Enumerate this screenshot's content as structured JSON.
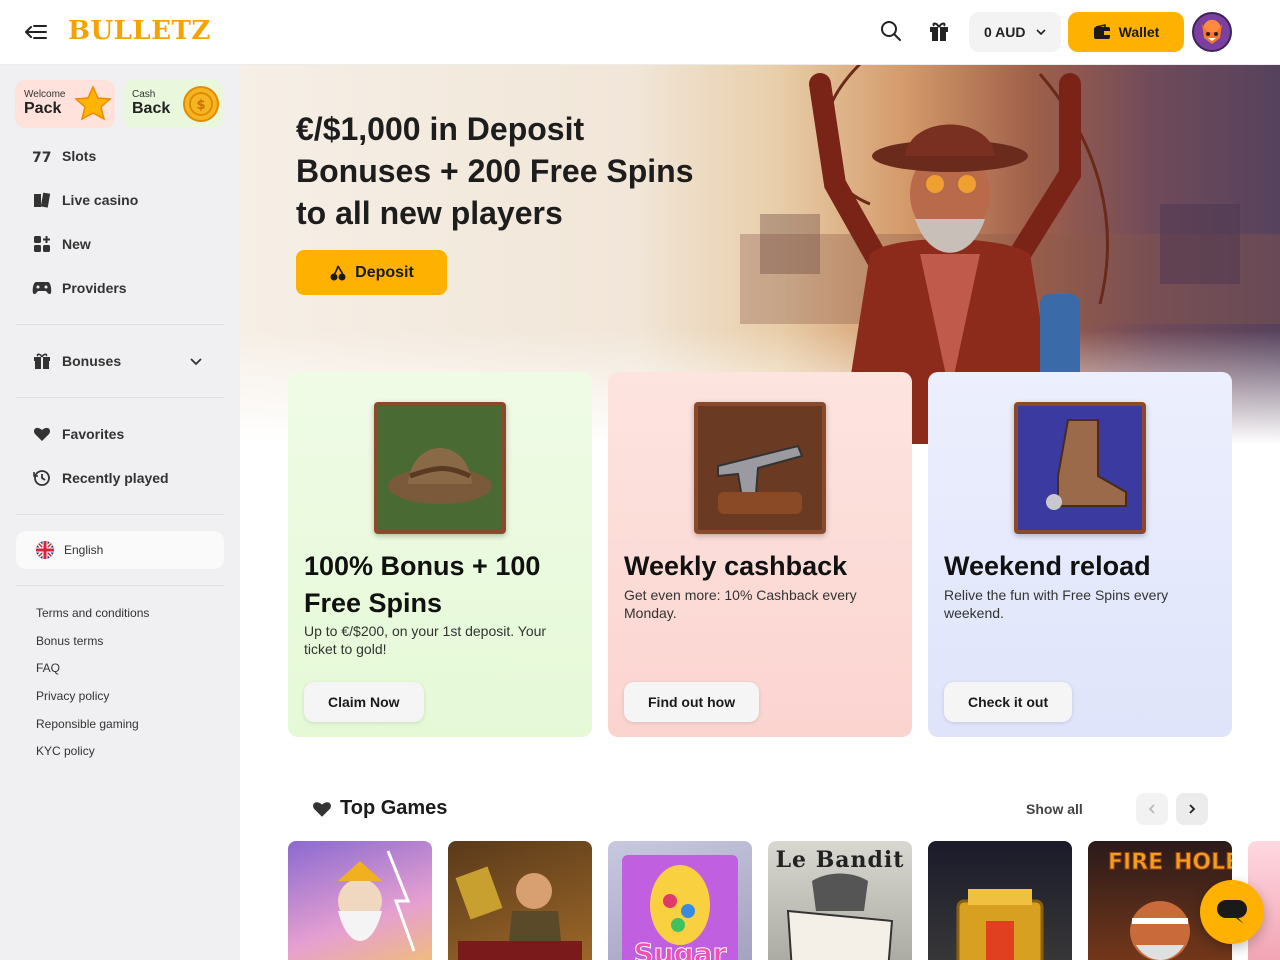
{
  "header": {
    "logo": "BULLETZ",
    "balance": "0 AUD",
    "wallet_label": "Wallet"
  },
  "sidebar": {
    "promos": [
      {
        "small": "Welcome",
        "big": "Pack"
      },
      {
        "small": "Cash",
        "big": "Back"
      }
    ],
    "nav": [
      {
        "label": "Slots",
        "icon": "slots-icon"
      },
      {
        "label": "Live casino",
        "icon": "live-casino-icon"
      },
      {
        "label": "New",
        "icon": "new-icon"
      },
      {
        "label": "Providers",
        "icon": "providers-icon"
      }
    ],
    "bonuses_label": "Bonuses",
    "favorites_label": "Favorites",
    "recent_label": "Recently played",
    "language": "English",
    "footer_links": [
      "Terms and conditions",
      "Bonus terms",
      "FAQ",
      "Privacy policy",
      "Reponsible gaming",
      "KYC policy"
    ]
  },
  "hero": {
    "title": "€/$1,000 in Deposit Bonuses + 200 Free Spins to all new players",
    "button": "Deposit"
  },
  "cards": [
    {
      "title": "100% Bonus + 100 Free Spins",
      "desc": "Up to €/$200, on your 1st deposit. Your ticket to gold!",
      "button": "Claim Now"
    },
    {
      "title": "Weekly cashback",
      "desc": "Get even more: 10% Cashback every Monday.",
      "button": "Find out how"
    },
    {
      "title": "Weekend reload",
      "desc": "Relive the fun with Free Spins every weekend.",
      "button": "Check it out"
    }
  ],
  "top_games": {
    "title": "Top Games",
    "show_all": "Show all",
    "game_labels": [
      "Le Bandit"
    ]
  },
  "colors": {
    "accent": "#ffb100",
    "sidebar_bg": "#f0f0f2"
  }
}
